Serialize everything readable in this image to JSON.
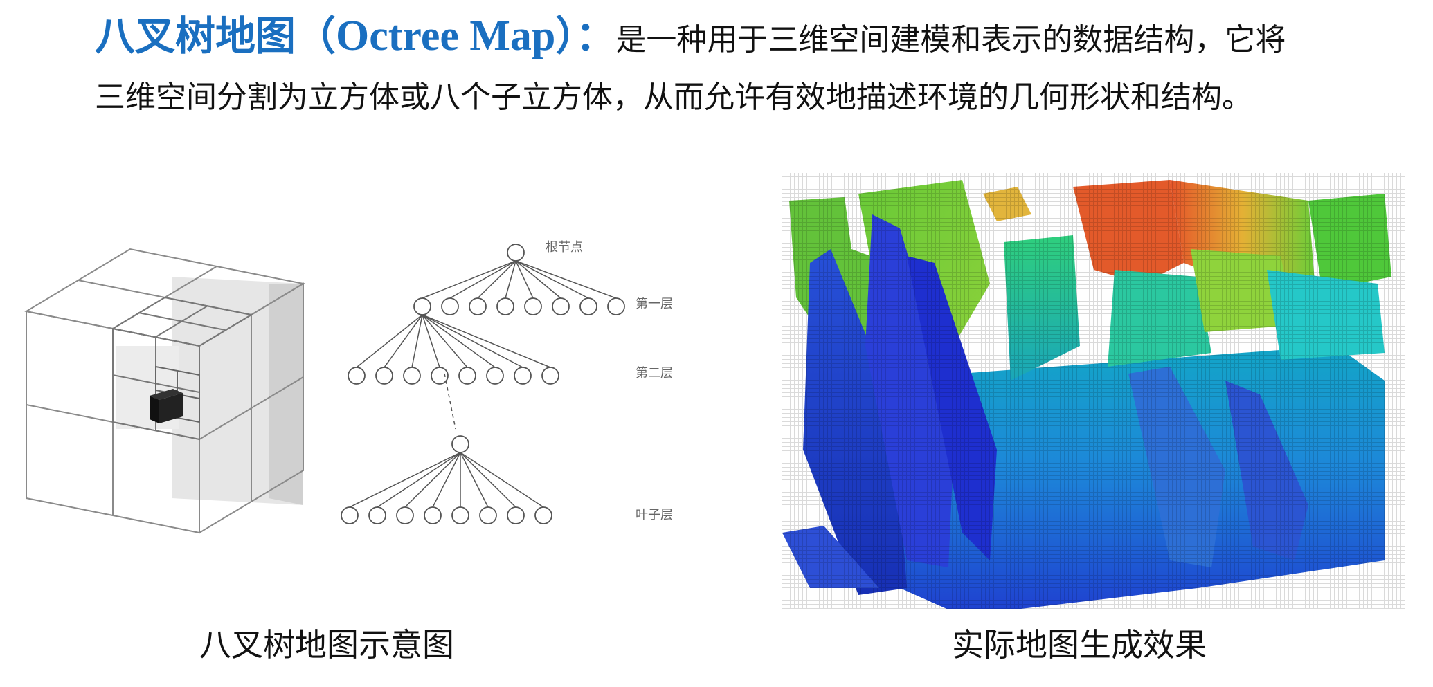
{
  "header": {
    "title_cn": "八叉树地图",
    "title_paren_open": "（",
    "title_en": "Octree Map",
    "title_paren_close": "）：",
    "desc_line1": "是一种用于三维空间建模和表示的数据结构，它将",
    "desc_line2": "三维空间分割为立方体或八个子立方体，从而允许有效地描述环境的几何形状和结构。"
  },
  "tree": {
    "levels": [
      "根节点",
      "第一层",
      "第二层",
      "叶子层"
    ]
  },
  "captions": {
    "left": "八叉树地图示意图",
    "right": "实际地图生成效果"
  },
  "colors": {
    "title": "#1a6fc0"
  }
}
